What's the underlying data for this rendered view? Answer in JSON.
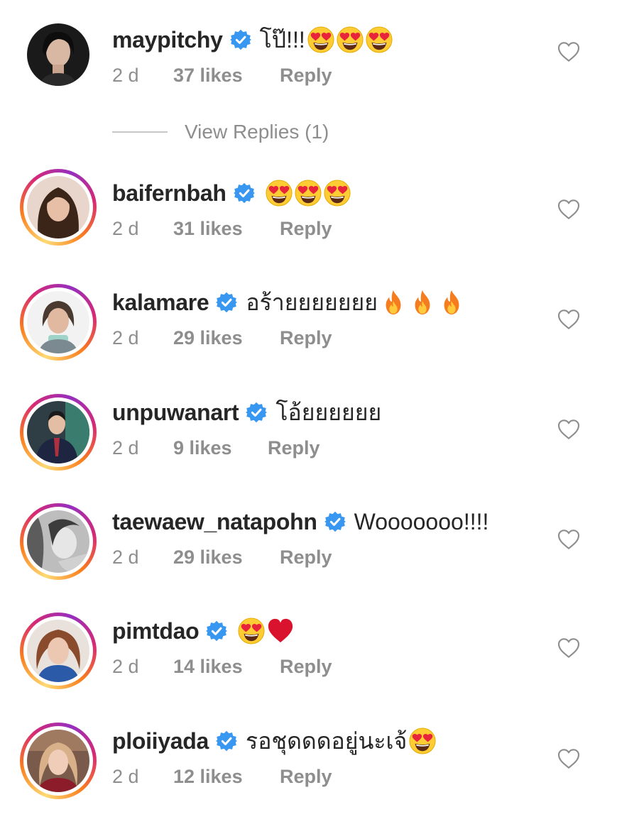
{
  "comments": [
    {
      "username": "maypitchy",
      "text": "โป๊!!!",
      "emoji": [
        "heart-eyes",
        "heart-eyes",
        "heart-eyes"
      ],
      "time": "2 d",
      "likes": "37 likes",
      "reply": "Reply",
      "story_ring": false
    },
    {
      "username": "baifernbah",
      "text": "",
      "emoji": [
        "heart-eyes",
        "heart-eyes",
        "heart-eyes"
      ],
      "time": "2 d",
      "likes": "31 likes",
      "reply": "Reply",
      "story_ring": true
    },
    {
      "username": "kalamare",
      "text": "อร้ายยยยยยย",
      "emoji": [
        "fire",
        "fire",
        "fire"
      ],
      "time": "2 d",
      "likes": "29 likes",
      "reply": "Reply",
      "story_ring": true
    },
    {
      "username": "unpuwanart",
      "text": "โอ้ยยยยยย",
      "emoji": [],
      "time": "2 d",
      "likes": "9 likes",
      "reply": "Reply",
      "story_ring": true
    },
    {
      "username": "taewaew_natapohn",
      "text": "Wooooooo!!!!",
      "emoji": [],
      "time": "2 d",
      "likes": "29 likes",
      "reply": "Reply",
      "story_ring": true
    },
    {
      "username": "pimtdao",
      "text": "",
      "emoji": [
        "heart-eyes",
        "red-heart"
      ],
      "time": "2 d",
      "likes": "14 likes",
      "reply": "Reply",
      "story_ring": true
    },
    {
      "username": "ploiiyada",
      "text": "รอชุดดดอยู่นะเจ้",
      "emoji": [
        "heart-eyes"
      ],
      "time": "2 d",
      "likes": "12 likes",
      "reply": "Reply",
      "story_ring": true
    }
  ],
  "view_replies": "View Replies (1)",
  "colors": {
    "text_primary": "#262626",
    "text_secondary": "#8e8e8e",
    "verified_blue": "#3897f0",
    "story_ring": [
      "#feda75",
      "#fa7e1e",
      "#d62976",
      "#962fbf"
    ]
  }
}
